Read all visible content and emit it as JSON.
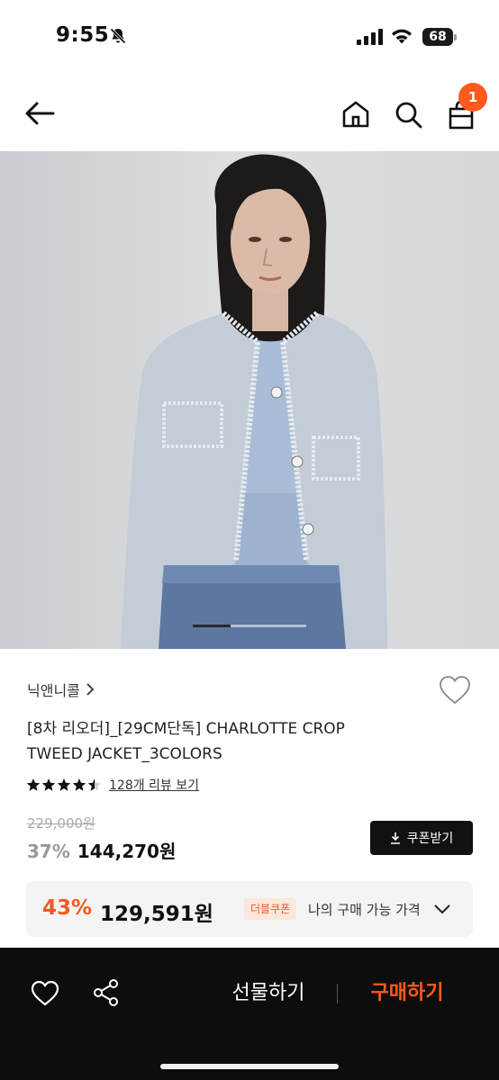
{
  "status_bar": {
    "time": "9:55",
    "battery": "68"
  },
  "nav": {
    "cart_count": "1"
  },
  "product": {
    "brand": "닉앤니콜",
    "name": "[8차 리오더]_[29CM단독] CHARLOTTE CROP TWEED JACKET_3COLORS",
    "rating": 4.5,
    "review_link": "128개 리뷰 보기",
    "original_price": "229,000원",
    "discount_rate": "37%",
    "sale_price": "144,270원",
    "coupon_button": "쿠폰받기"
  },
  "best_price": {
    "rate": "43%",
    "price": "129,591원",
    "badge": "더블쿠폰",
    "label": "나의 구매 가능 가격"
  },
  "bottom_bar": {
    "gift_label": "선물하기",
    "buy_label": "구매하기"
  },
  "gallery": {
    "current_index": 2,
    "total": 3
  },
  "colors": {
    "accent": "#ff5a1e",
    "discount_best": "#f05a22",
    "dark": "#0d0d0d"
  }
}
